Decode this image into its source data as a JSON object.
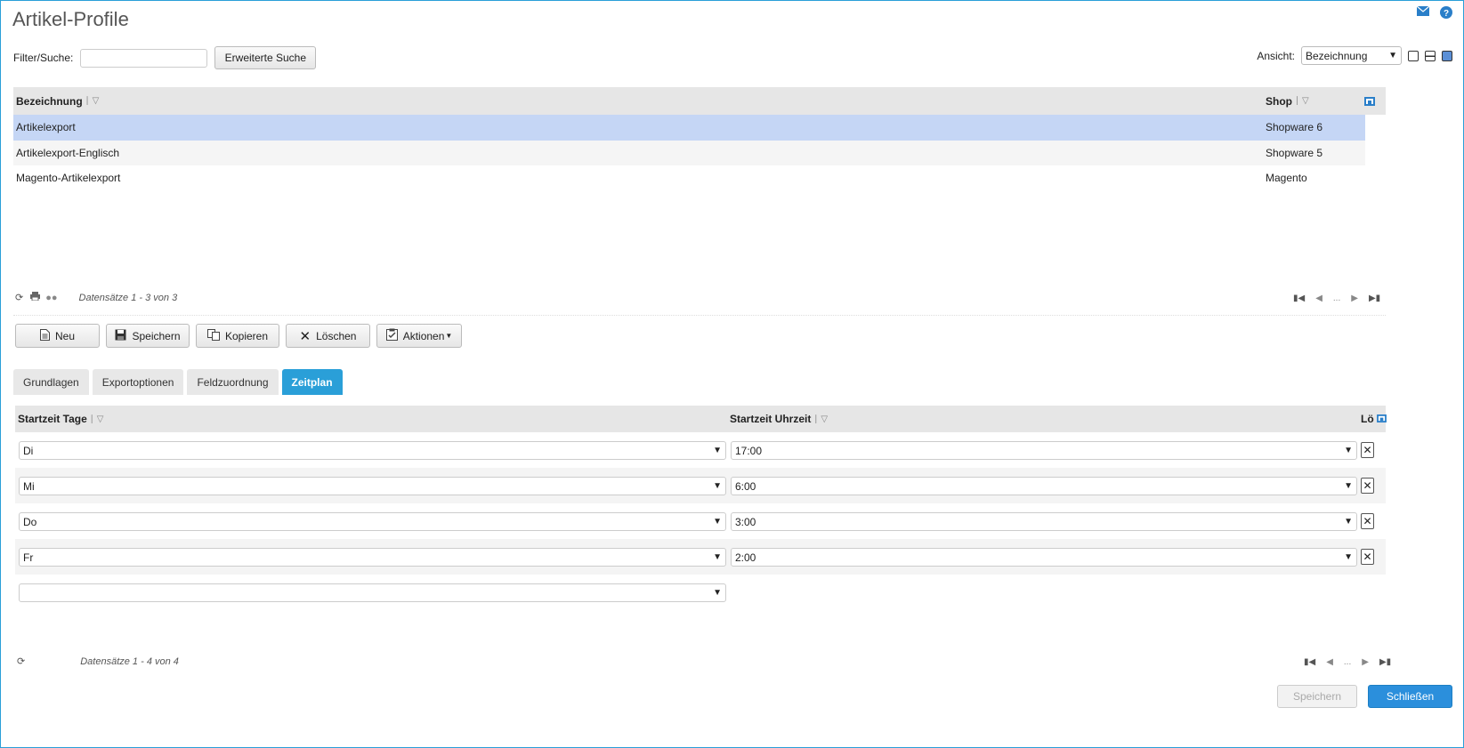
{
  "page": {
    "title": "Artikel-Profile"
  },
  "filter": {
    "label": "Filter/Suche:",
    "value": "",
    "advanced_label": "Erweiterte Suche"
  },
  "view": {
    "label": "Ansicht:",
    "selected": "Bezeichnung"
  },
  "grid1": {
    "headers": {
      "name": "Bezeichnung",
      "shop": "Shop"
    },
    "rows": [
      {
        "name": "Artikelexport",
        "shop": "Shopware 6"
      },
      {
        "name": "Artikelexport-Englisch",
        "shop": "Shopware 5"
      },
      {
        "name": "Magento-Artikelexport",
        "shop": "Magento"
      }
    ],
    "footer": "Datensätze 1 - 3 von 3",
    "pager_ellipsis": "..."
  },
  "toolbar": {
    "new": "Neu",
    "save": "Speichern",
    "copy": "Kopieren",
    "delete": "Löschen",
    "actions": "Aktionen"
  },
  "tabs": [
    "Grundlagen",
    "Exportoptionen",
    "Feldzuordnung",
    "Zeitplan"
  ],
  "grid2": {
    "headers": {
      "day": "Startzeit Tage",
      "time": "Startzeit Uhrzeit",
      "del": "Lö"
    },
    "rows": [
      {
        "day": "Di",
        "time": "17:00"
      },
      {
        "day": "Mi",
        "time": "6:00"
      },
      {
        "day": "Do",
        "time": "3:00"
      },
      {
        "day": "Fr",
        "time": "2:00"
      }
    ],
    "empty_day": "",
    "footer": "Datensätze 1 - 4 von 4",
    "pager_ellipsis": "..."
  },
  "bottom": {
    "save": "Speichern",
    "close": "Schließen"
  },
  "colors": {
    "accent": "#2a9fd8",
    "selected_row": "#c5d6f5",
    "primary_button": "#2b8fdc"
  }
}
